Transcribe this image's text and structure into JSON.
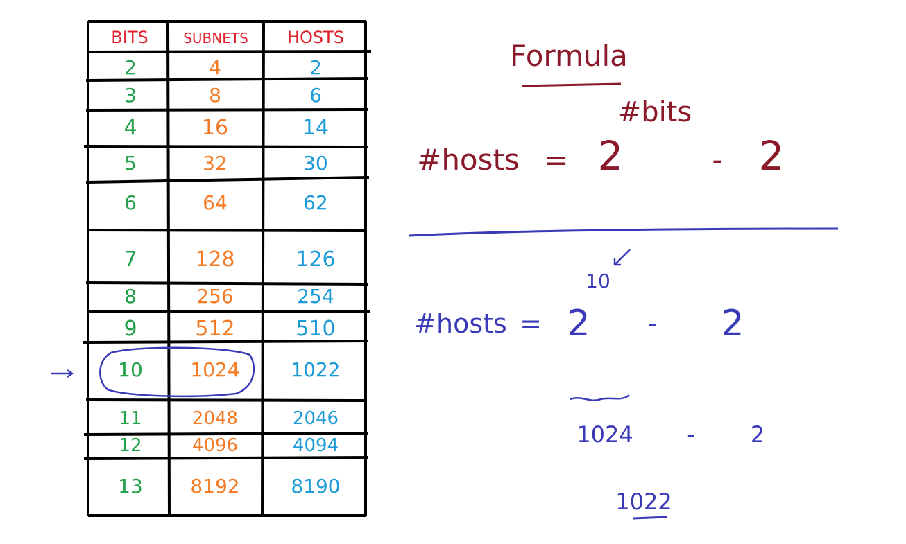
{
  "table": {
    "headers": {
      "bits": "BITS",
      "subnets": "SUBNETS",
      "hosts": "HOSTS"
    },
    "rows": [
      {
        "bits": "2",
        "subnets": "4",
        "hosts": "2"
      },
      {
        "bits": "3",
        "subnets": "8",
        "hosts": "6"
      },
      {
        "bits": "4",
        "subnets": "16",
        "hosts": "14"
      },
      {
        "bits": "5",
        "subnets": "32",
        "hosts": "30"
      },
      {
        "bits": "6",
        "subnets": "64",
        "hosts": "62"
      },
      {
        "bits": "7",
        "subnets": "128",
        "hosts": "126"
      },
      {
        "bits": "8",
        "subnets": "256",
        "hosts": "254"
      },
      {
        "bits": "9",
        "subnets": "512",
        "hosts": "510"
      },
      {
        "bits": "10",
        "subnets": "1024",
        "hosts": "1022"
      },
      {
        "bits": "11",
        "subnets": "2048",
        "hosts": "2046"
      },
      {
        "bits": "12",
        "subnets": "4096",
        "hosts": "4094"
      },
      {
        "bits": "13",
        "subnets": "8192",
        "hosts": "8190"
      }
    ],
    "highlighted_row": 8
  },
  "formula": {
    "title": "Formula",
    "lhs": "#hosts",
    "equals": "=",
    "base": "2",
    "exponent": "#bits",
    "minus": "-",
    "subtract": "2"
  },
  "example": {
    "lhs": "#hosts",
    "equals": "=",
    "base": "2",
    "exponent": "10",
    "minus": "-",
    "subtract": "2",
    "step_value": "1024",
    "step_minus": "-",
    "step_subtract": "2",
    "result": "1022"
  },
  "colors": {
    "header": "#e0202a",
    "bits": "#22a04a",
    "subnets": "#f47a24",
    "hosts": "#1a9ad6",
    "formula": "#8a1a2a",
    "example": "#3a3ab8",
    "grid": "#000000"
  }
}
